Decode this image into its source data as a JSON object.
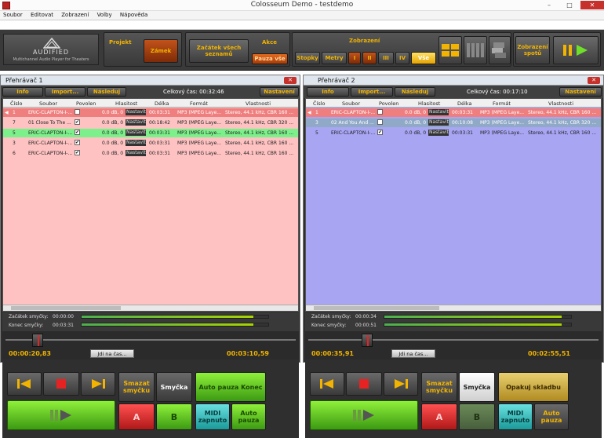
{
  "window": {
    "title": "Colosseum Demo - testdemo",
    "minimize": "–",
    "maximize": "□",
    "close": "✕"
  },
  "menu": [
    "Soubor",
    "Editovat",
    "Zobrazení",
    "Volby",
    "Nápověda"
  ],
  "logo": {
    "name": "AUDIFIED",
    "subtitle": "Multichannel Audio Player for Theaters"
  },
  "toolbar": {
    "projekt_label": "Projekt",
    "zamek": "Zámek",
    "zacatek": "Začátek všech seznamů",
    "akce_label": "Akce",
    "pauza_vse": "Pauza vše",
    "zobrazeni_label": "Zobrazení",
    "stopky": "Stopky",
    "metry": "Metry",
    "views": [
      "I",
      "II",
      "III",
      "IV",
      "Vše"
    ],
    "zobrazeni_spotu": "Zobrazení spotů"
  },
  "columns": [
    "Číslo",
    "Soubor",
    "Povolen",
    "Hlasitost",
    "Délka",
    "Formát",
    "Vlastnosti"
  ],
  "player1": {
    "title": "Přehrávač 1",
    "info": "Info",
    "import": "Import...",
    "nasleduj": "Následuj",
    "total": "Celkový čas: 00:32:46",
    "nastaveni": "Nastavení",
    "rows": [
      {
        "num": "1",
        "file": "ERIC-CLAPTON-I-...",
        "check": "✔",
        "vol": "0.0 dB, 0",
        "nast": "Nastavit",
        "len": "00:03:31",
        "fmt": "MP3 (MPEG Laye...",
        "props": "Stereo, 44.1 kHz, CBR 160 ...",
        "bg": "#ef7f7f",
        "color": "#fff"
      },
      {
        "num": "7",
        "file": "01 Close To The ...",
        "check": "✔",
        "vol": "0.0 dB, 0",
        "nast": "Nastavit",
        "len": "00:18:42",
        "fmt": "MP3 (MPEG Laye...",
        "props": "Stereo, 44.1 kHz, CBR 320 ...",
        "bg": "#ffc2c2",
        "color": "#222"
      },
      {
        "num": "5",
        "file": "ERIC-CLAPTON-I-...",
        "check": "✔",
        "vol": "0.0 dB, 0",
        "nast": "Nastavit",
        "len": "00:03:31",
        "fmt": "MP3 (MPEG Laye...",
        "props": "Stereo, 44.1 kHz, CBR 160 ...",
        "bg": "#7cf08a",
        "color": "#222"
      },
      {
        "num": "3",
        "file": "ERIC-CLAPTON-I-...",
        "check": "✔",
        "vol": "0.0 dB, 0",
        "nast": "Nastavit",
        "len": "00:03:31",
        "fmt": "MP3 (MPEG Laye...",
        "props": "Stereo, 44.1 kHz, CBR 160 ...",
        "bg": "#ffc2c2",
        "color": "#222"
      },
      {
        "num": "6",
        "file": "ERIC-CLAPTON-I-...",
        "check": "✔",
        "vol": "0.0 dB, 0",
        "nast": "Nastavit",
        "len": "00:03:31",
        "fmt": "MP3 (MPEG Laye...",
        "props": "Stereo, 44.1 kHz, CBR 160 ...",
        "bg": "#ffc2c2",
        "color": "#222"
      }
    ],
    "loop_start_label": "Začátek smyčky:",
    "loop_start": "00:00:00",
    "loop_end_label": "Konec smyčky:",
    "loop_end": "00:03:31",
    "time_elapsed": "00:00:20,83",
    "jdi": "Jdi na čas...",
    "time_remaining": "00:03:10,59",
    "meter_level": 0.92,
    "seek_position": 0.1,
    "smazat": "Smazat smyčku",
    "smycka": "Smyčka",
    "auto_pauza": "Auto pauza Konec",
    "a": "A",
    "b": "B",
    "midi": "MIDI zapnuto",
    "auto_pauza2": "Auto pauza"
  },
  "player2": {
    "title": "Přehrávač 2",
    "info": "Info",
    "import": "Import...",
    "nasleduj": "Následuj",
    "total": "Celkový čas: 00:17:10",
    "nastaveni": "Nastavení",
    "rows": [
      {
        "num": "1",
        "file": "ERIC-CLAPTON-I-...",
        "check": "✔",
        "vol": "0.0 dB, 0",
        "nast": "Nastavit",
        "len": "00:03:31",
        "fmt": "MP3 (MPEG Laye...",
        "props": "Stereo, 44.1 kHz, CBR 160 ...",
        "bg": "#ef7f7f",
        "color": "#fff"
      },
      {
        "num": "3",
        "file": "02 And You And ...",
        "check": "✔",
        "vol": "0.0 dB, 0",
        "nast": "Nastavit",
        "len": "00:10:08",
        "fmt": "MP3 (MPEG Laye...",
        "props": "Stereo, 44.1 kHz, CBR 320 ...",
        "bg": "#8fa9c6",
        "color": "#fff"
      },
      {
        "num": "5",
        "file": "ERIC-CLAPTON-I-...",
        "check": "✔",
        "vol": "0.0 dB, 0",
        "nast": "Nastavit",
        "len": "00:03:31",
        "fmt": "MP3 (MPEG Laye...",
        "props": "Stereo, 44.1 kHz, CBR 160 ...",
        "bg": "#a8a5f3",
        "color": "#222"
      }
    ],
    "loop_start_label": "Začátek smyčky:",
    "loop_start": "00:00:34",
    "loop_end_label": "Konec smyčky:",
    "loop_end": "00:00:51",
    "time_elapsed": "00:00:35,91",
    "jdi": "Jdi na čas...",
    "time_remaining": "00:02:55,51",
    "meter_level": 0.95,
    "seek_position": 0.2,
    "smazat": "Smazat smyčku",
    "smycka": "Smyčka",
    "opakuj": "Opakuj skladbu",
    "a": "A",
    "b": "B",
    "midi": "MIDI zapnuto",
    "auto_pauza2": "Auto pauza"
  }
}
